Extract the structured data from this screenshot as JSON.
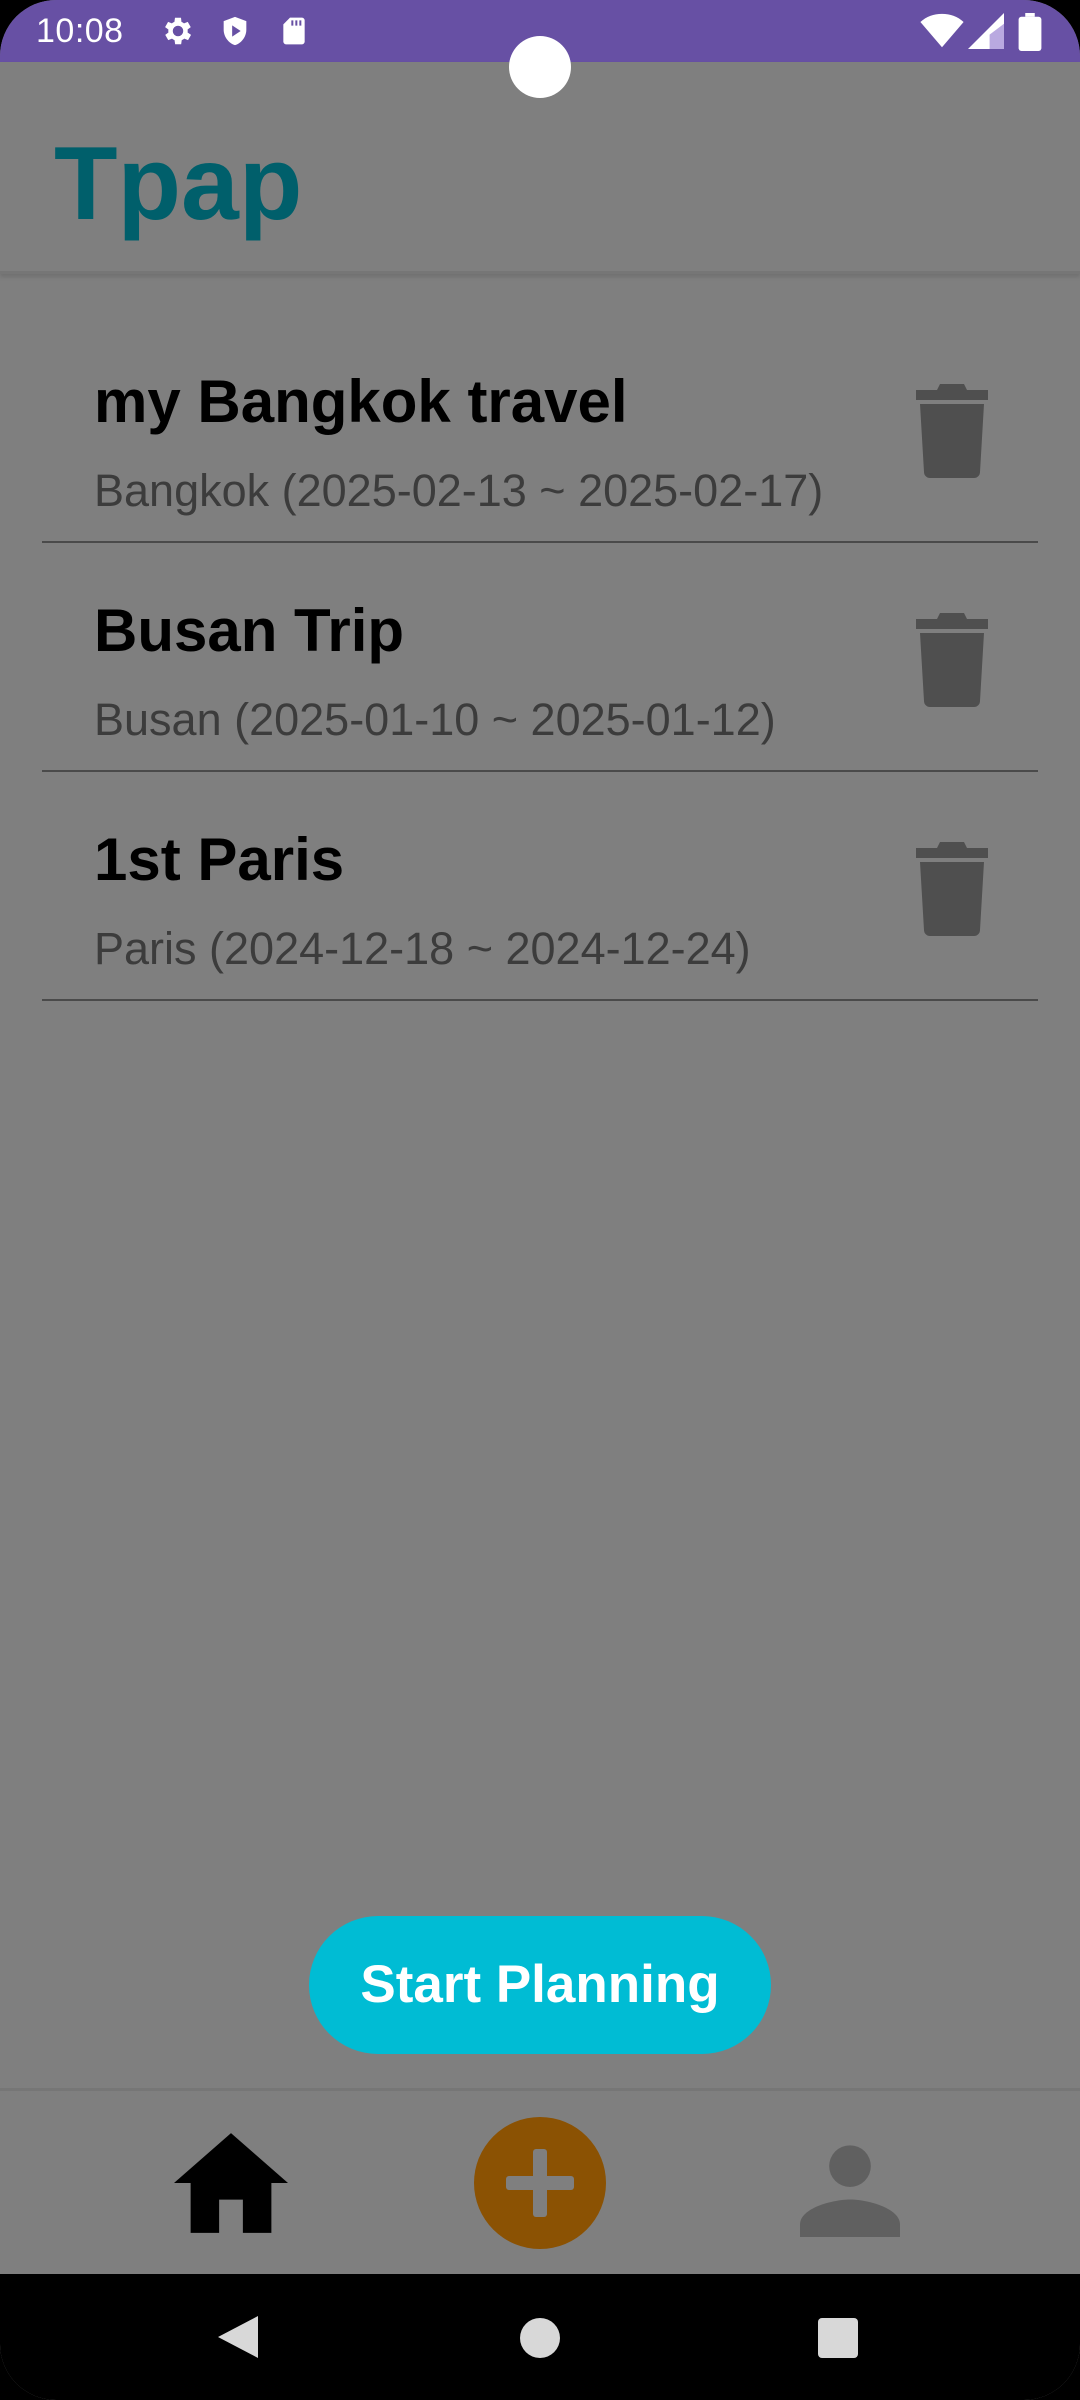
{
  "status_bar": {
    "time": "10:08",
    "left_icons": [
      "settings-icon",
      "shield-icon",
      "sd-card-icon"
    ],
    "right_icons": [
      "wifi-icon",
      "signal-icon",
      "battery-icon"
    ]
  },
  "app_bar": {
    "title": "Tpap"
  },
  "trips": [
    {
      "name": "my Bangkok travel",
      "meta": "Bangkok (2025-02-13 ~ 2025-02-17)"
    },
    {
      "name": "Busan Trip",
      "meta": "Busan (2025-01-10 ~ 2025-01-12)"
    },
    {
      "name": "1st Paris",
      "meta": "Paris (2024-12-18 ~ 2024-12-24)"
    }
  ],
  "start_button": {
    "label": "Start Planning"
  },
  "bottom_nav": {
    "items": [
      {
        "icon": "home-icon",
        "selected": true
      },
      {
        "icon": "add-icon",
        "selected": false
      },
      {
        "icon": "person-icon",
        "selected": false
      }
    ]
  },
  "system_nav": [
    "back-icon",
    "home-circle-icon",
    "recents-icon"
  ],
  "colors": {
    "status_bar": "#6750a4",
    "background": "#7f7f7f",
    "title": "#005f6b",
    "primary_button": "#00bcd4",
    "add_button": "#8b5203",
    "delete_icon": "#4f4f4f"
  }
}
